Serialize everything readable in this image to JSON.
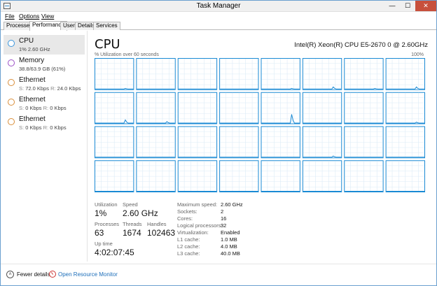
{
  "window": {
    "title": "Task Manager",
    "controls": {
      "minimize": "—",
      "maximize": "☐",
      "close": "✕"
    }
  },
  "menu": [
    {
      "label": "File"
    },
    {
      "label": "Options"
    },
    {
      "label": "View"
    }
  ],
  "tabs": [
    {
      "label": "Processes",
      "active": false
    },
    {
      "label": "Performance",
      "active": true
    },
    {
      "label": "Users",
      "active": false
    },
    {
      "label": "Details",
      "active": false
    },
    {
      "label": "Services",
      "active": false
    }
  ],
  "sidebar": {
    "items": [
      {
        "title": "CPU",
        "sub": "1%  2.60 GHz",
        "color": "#3a96dd",
        "selected": true
      },
      {
        "title": "Memory",
        "sub": "38.8/63.9 GB (61%)",
        "color": "#9b4fc6",
        "selected": false
      },
      {
        "title": "Ethernet",
        "sub_send_label": "S:",
        "sub_send": "72.0 Kbps",
        "sub_recv_label": "R:",
        "sub_recv": "24.0 Kbps",
        "color": "#d98e3a",
        "selected": false
      },
      {
        "title": "Ethernet",
        "sub_send_label": "S:",
        "sub_send": "0 Kbps",
        "sub_recv_label": "R:",
        "sub_recv": "0 Kbps",
        "color": "#d98e3a",
        "selected": false
      },
      {
        "title": "Ethernet",
        "sub_send_label": "S:",
        "sub_send": "0 Kbps",
        "sub_recv_label": "R:",
        "sub_recv": "0 Kbps",
        "color": "#d98e3a",
        "selected": false
      }
    ]
  },
  "main": {
    "title": "CPU",
    "model": "Intel(R) Xeon(R) CPU E5-2670 0 @ 2.60GHz",
    "graph_caption": "% Utilization over 60 seconds",
    "graph_max": "100%",
    "graph_color": "#1a8ad4",
    "graph_fill": "#f1f7fd",
    "spikes": [
      [
        0.02,
        0,
        0,
        0,
        0.02,
        0.07,
        0.02,
        0.07
      ],
      [
        0.11,
        0.05,
        0,
        0,
        0.3,
        0,
        0,
        0.03
      ],
      [
        0,
        0,
        0,
        0,
        0,
        0.04,
        0,
        0
      ],
      [
        0,
        0,
        0,
        0,
        0,
        0,
        0,
        0
      ]
    ]
  },
  "stats": {
    "utilization_label": "Utilization",
    "utilization": "1%",
    "speed_label": "Speed",
    "speed": "2.60 GHz",
    "processes_label": "Processes",
    "processes": "63",
    "threads_label": "Threads",
    "threads": "1674",
    "handles_label": "Handles",
    "handles": "102463",
    "uptime_label": "Up time",
    "uptime": "4:02:07:45",
    "specs": [
      {
        "label": "Maximum speed:",
        "value": "2.60 GHz"
      },
      {
        "label": "Sockets:",
        "value": "2"
      },
      {
        "label": "Cores:",
        "value": "16"
      },
      {
        "label": "Logical processors:",
        "value": "32"
      },
      {
        "label": "Virtualization:",
        "value": "Enabled"
      },
      {
        "label": "L1 cache:",
        "value": "1.0 MB"
      },
      {
        "label": "L2 cache:",
        "value": "4.0 MB"
      },
      {
        "label": "L3 cache:",
        "value": "40.0 MB"
      }
    ]
  },
  "footer": {
    "fewer_details": "Fewer details",
    "open_monitor": "Open Resource Monitor"
  }
}
